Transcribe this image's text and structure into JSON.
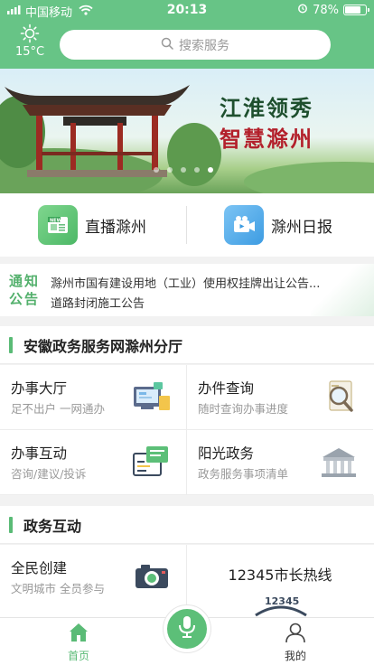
{
  "status_bar": {
    "carrier": "中国移动",
    "time": "20:13",
    "battery": "78%",
    "battery_level": 0.78
  },
  "weather": {
    "temperature": "15°C"
  },
  "search": {
    "placeholder": "搜索服务"
  },
  "banner": {
    "line1": "江淮领秀",
    "line2": "智慧滁州",
    "slide_count": 5,
    "active_slide": 5
  },
  "quick_links": [
    {
      "label": "直播滁州",
      "icon": "news-icon"
    },
    {
      "label": "滁州日报",
      "icon": "video-camera-icon"
    }
  ],
  "notice": {
    "tag": "通知公告",
    "items": [
      "滁州市国有建设用地（工业）使用权挂牌出让公告...",
      "道路封闭施工公告"
    ]
  },
  "sections": [
    {
      "title": "安徽政务服务网滁州分厅",
      "items": [
        {
          "title": "办事大厅",
          "subtitle": "足不出户 一网通办",
          "icon": "service-hall-icon"
        },
        {
          "title": "办件查询",
          "subtitle": "随时查询办事进度",
          "icon": "magnifier-document-icon"
        },
        {
          "title": "办事互动",
          "subtitle": "咨询/建议/投诉",
          "icon": "chat-icon"
        },
        {
          "title": "阳光政务",
          "subtitle": "政务服务事项清单",
          "icon": "government-building-icon"
        }
      ]
    },
    {
      "title": "政务互动",
      "items": [
        {
          "title": "全民创建",
          "subtitle": "文明城市 全员参与",
          "icon": "camera-icon"
        },
        {
          "title": "12345市长热线",
          "subtitle": "",
          "icon": "hotline-12345-icon",
          "hotline_badge": "12345"
        }
      ]
    }
  ],
  "tabbar": {
    "home": "首页",
    "mine": "我的",
    "active": "home"
  },
  "colors": {
    "brand_green": "#67c486",
    "accent_green": "#5abb76",
    "banner_red": "#b3202b"
  }
}
